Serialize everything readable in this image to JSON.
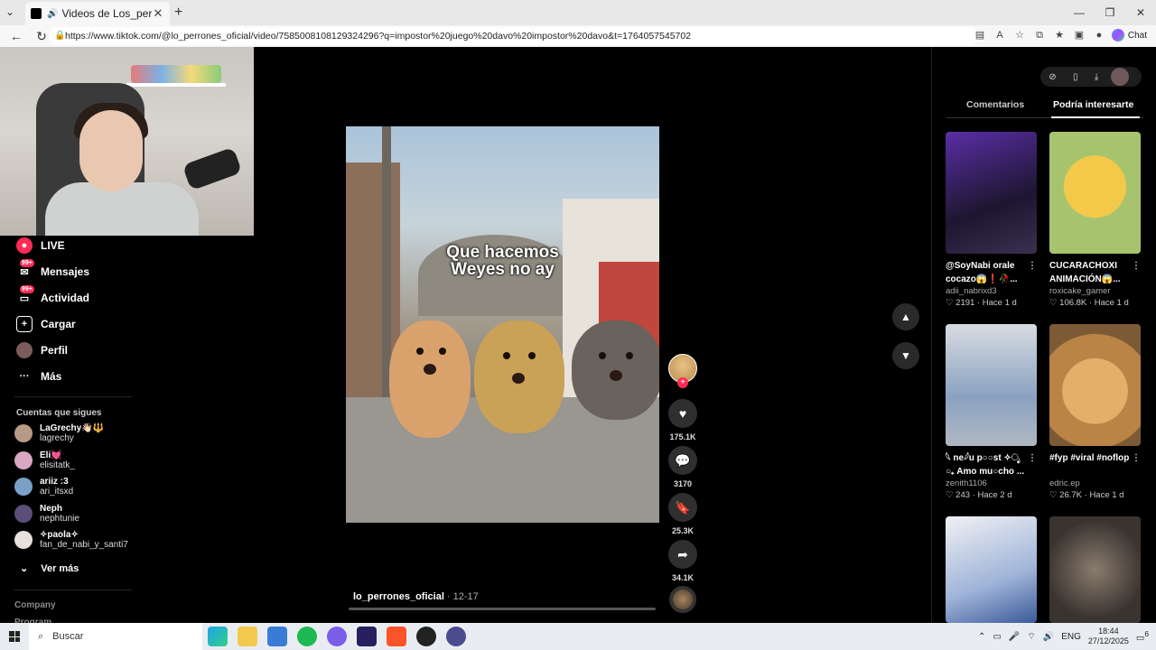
{
  "browser": {
    "tab_title": "Videos de Los_perrones (@lo_",
    "tab_close": "✕",
    "new_tab": "+",
    "url": "https://www.tiktok.com/@lo_perrones_oficial/video/7585008108129324296?q=impostor%20juego%20davo%20impostor%20davo&t=1764057545702",
    "chat_label": "Chat",
    "window_controls": [
      "—",
      "❐",
      "✕"
    ]
  },
  "sidebar": {
    "items": [
      {
        "label": "LIVE",
        "icon": "live-icon",
        "badge": ""
      },
      {
        "label": "Mensajes",
        "icon": "messages-icon",
        "badge": "99+"
      },
      {
        "label": "Actividad",
        "icon": "activity-icon",
        "badge": "99+"
      },
      {
        "label": "Cargar",
        "icon": "upload-icon",
        "badge": ""
      },
      {
        "label": "Perfil",
        "icon": "profile-icon",
        "badge": ""
      },
      {
        "label": "Más",
        "icon": "more-icon",
        "badge": ""
      }
    ],
    "following_title": "Cuentas que sigues",
    "following": [
      {
        "name": "LaGrechy👋🏻🔱",
        "handle": "lagrechy",
        "color": "#b79a86"
      },
      {
        "name": "Eli💓",
        "handle": "elisitatk_",
        "color": "#d9a6c4"
      },
      {
        "name": "ariiz :3",
        "handle": "ari_itsxd",
        "color": "#7aa0c8"
      },
      {
        "name": "Neph",
        "handle": "nephtunie",
        "color": "#5b4e7a"
      },
      {
        "name": "✧paola✧",
        "handle": "fan_de_nabi_y_santi7",
        "color": "#e8e0dc"
      }
    ],
    "see_more": "Ver más",
    "company": "Company",
    "program": "Program"
  },
  "video": {
    "caption_line1": "Que hacemos",
    "caption_line2": "Weyes no ay",
    "author": "lo_perrones_oficial",
    "date": " · 12-17",
    "progress": 0.0
  },
  "actions": {
    "likes": "175.1K",
    "comments": "3170",
    "saves": "25.3K",
    "shares": "34.1K"
  },
  "right_panel": {
    "tab_comments": "Comentarios",
    "tab_suggested": "Podría interesarte",
    "cards": [
      {
        "title": "@SoyNabi orale cocazo😱❗🥀...",
        "user": "adii_nabrixd3",
        "likes": "2191",
        "age": "Hace 1 d",
        "bg": "#2b1f4d"
      },
      {
        "title": "CUCARACHOXI ANIMACIÓN😱...",
        "user": "roxicake_gamer",
        "likes": "106.8K",
        "age": "Hace 1 d",
        "bg": "#a7c36d"
      },
      {
        "title": "𓆩 ne𓆪u p○○st ✧ೃ ○₊ Amo mu○cho ...",
        "user": "zenith1106",
        "likes": "243",
        "age": "Hace 2 d",
        "bg": "#9fb0c4"
      },
      {
        "title": "#fyp #viral #noflop",
        "user": "edric.ep",
        "likes": "26.7K",
        "age": "Hace 1 d",
        "bg": "#c99a5a"
      },
      {
        "title": "",
        "user": "",
        "likes": "",
        "age": "",
        "bg": "#e8e8ec"
      },
      {
        "title": "",
        "user": "",
        "likes": "",
        "age": "",
        "bg": "#4a4440"
      }
    ]
  },
  "taskbar": {
    "search_placeholder": "Buscar",
    "lang": "ENG",
    "time": "18:44",
    "date": "27/12/2025",
    "notif_count": "6"
  }
}
